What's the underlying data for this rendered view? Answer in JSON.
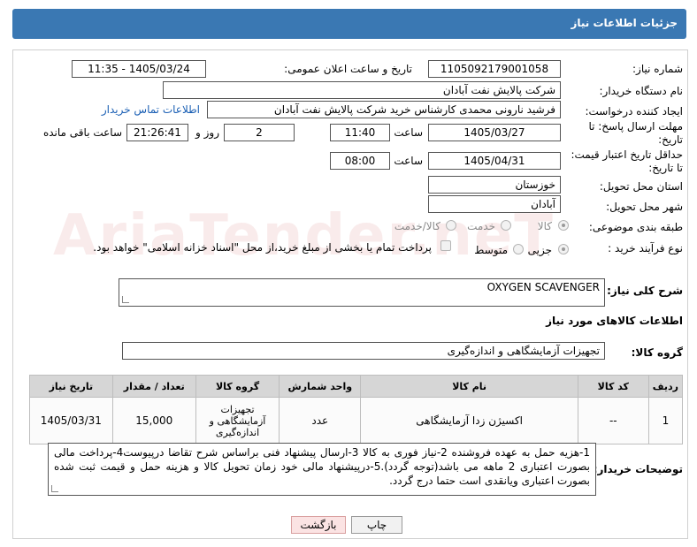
{
  "header": {
    "title": "جزئیات اطلاعات نیاز"
  },
  "form": {
    "need_number": {
      "label": "شماره نیاز:",
      "value": "1105092179001058"
    },
    "announce": {
      "label": "تاریخ و ساعت اعلان عمومی:",
      "value": "1405/03/24 - 11:35"
    },
    "buyer_org": {
      "label": "نام دستگاه خریدار:",
      "value": "شرکت پالایش نفت آبادان"
    },
    "creator": {
      "label": "ایجاد کننده درخواست:",
      "value": "فرشید نارونی محمدی کارشناس خرید  شرکت پالایش نفت آبادان",
      "contact_link": "اطلاعات تماس خریدار"
    },
    "reply_deadline": {
      "label_line1": "مهلت ارسال پاسخ: تا",
      "label_line2": "تاریخ:",
      "date": "1405/03/27",
      "time_label": "ساعت",
      "time": "11:40",
      "days": "2",
      "days_label": "روز و",
      "remaining": "21:26:41",
      "remaining_label": "ساعت باقی مانده"
    },
    "price_validity": {
      "label_line1": "حداقل تاریخ اعتبار قیمت:",
      "label_line2": "تا تاریخ:",
      "date": "1405/04/31",
      "time_label": "ساعت",
      "time": "08:00"
    },
    "province": {
      "label": "استان محل تحویل:",
      "value": "خوزستان"
    },
    "city": {
      "label": "شهر محل تحویل:",
      "value": "آبادان"
    },
    "category": {
      "label": "طبقه بندی موضوعی:",
      "options": [
        "کالا",
        "خدمت",
        "کالا/خدمت"
      ],
      "selected": "کالا"
    },
    "process": {
      "label": "نوع فرآیند خرید :",
      "options": [
        "جزیی",
        "متوسط"
      ],
      "selected": "جزیی",
      "payment_note": "پرداخت تمام یا بخشی از مبلغ خرید،از محل \"اسناد خزانه اسلامی\" خواهد بود."
    }
  },
  "description": {
    "label": "شرح کلی نیاز:",
    "value": "OXYGEN SCAVENGER"
  },
  "goods_section": {
    "title": "اطلاعات کالاهای مورد نیاز"
  },
  "goods_group": {
    "label": "گروه کالا:",
    "value": "تجهیزات آزمایشگاهی و اندازه‌گیری"
  },
  "table": {
    "headers": [
      "ردیف",
      "کد کالا",
      "نام کالا",
      "واحد شمارش",
      "گروه کالا",
      "تعداد / مقدار",
      "تاریخ نیاز"
    ],
    "rows": [
      [
        "1",
        "--",
        "اکسیژن زدا آزمایشگاهی",
        "عدد",
        "تجهیزات آزمایشگاهی و اندازه‌گیری",
        "15,000",
        "1405/03/31"
      ]
    ]
  },
  "buyer_notes": {
    "label": "توضیحات خریدار:",
    "value": "1-هزیه حمل به عهده فروشنده 2-نیاز فوری به کالا 3-ارسال پیشنهاد فنی براساس شرح تقاضا درپیوست4-پرداخت مالی بصورت اعتباری 2 ماهه می باشد(توجه گردد).5-درپیشنهاد مالی خود زمان تحویل کالا و هزینه حمل و قیمت ثبت شده بصورت اعتباری ویانقدی است حتما درج گردد."
  },
  "buttons": {
    "print": "چاپ",
    "back": "بازگشت"
  },
  "watermark": "AriaTender.neT"
}
